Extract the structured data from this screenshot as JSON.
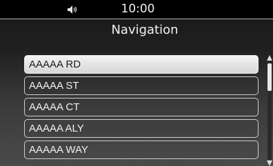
{
  "status_bar": {
    "time": "10:00",
    "volume_icon": "volume-icon"
  },
  "header": {
    "title": "Navigation"
  },
  "list": {
    "items": [
      {
        "label": "AAAAA RD",
        "selected": true
      },
      {
        "label": "AAAAA ST",
        "selected": false
      },
      {
        "label": "AAAAA CT",
        "selected": false
      },
      {
        "label": "AAAAA ALY",
        "selected": false
      },
      {
        "label": "AAAAA WAY",
        "selected": false
      }
    ]
  },
  "colors": {
    "selected_bg": "#e6e6e6",
    "row_border": "#cfcfcf",
    "text": "#f0f0f0"
  }
}
